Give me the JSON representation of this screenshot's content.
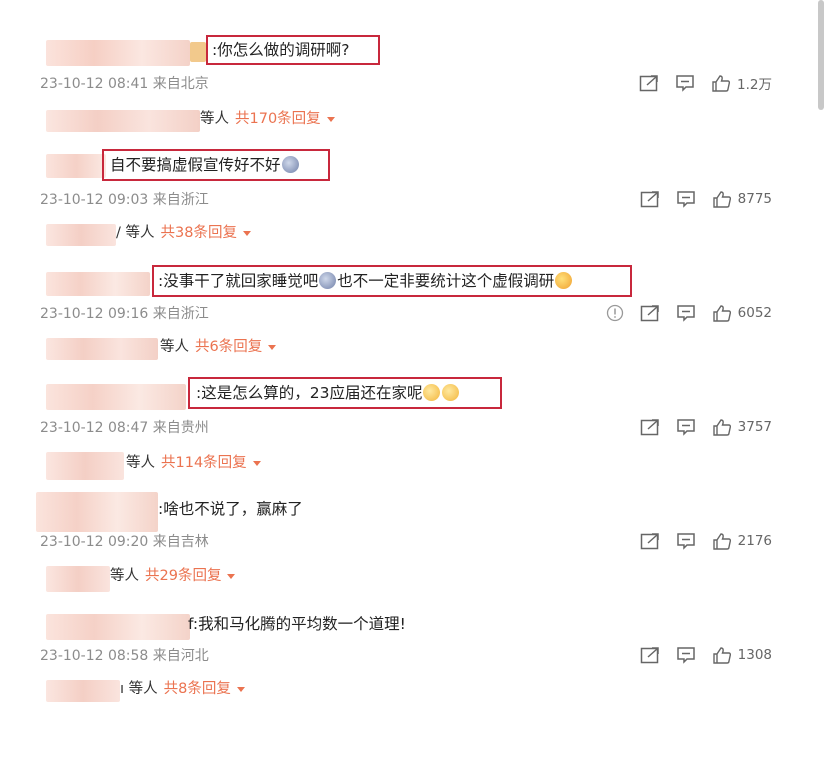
{
  "colors": {
    "accent": "#eb7350",
    "highlight_box": "#c8283c",
    "meta": "#8c8c8c"
  },
  "comments": [
    {
      "text": ":你怎么做的调研啊?",
      "time": "23-10-12 08:41",
      "from": "来自北京",
      "likes": "1.2万",
      "reply_who": "等人",
      "reply_count": "共170条回复"
    },
    {
      "text": "自不要搞虚假宣传好不好",
      "time": "23-10-12 09:03",
      "from": "来自浙江",
      "likes": "8775",
      "reply_who": "/ 等人",
      "reply_count": "共38条回复"
    },
    {
      "text": ":没事干了就回家睡觉吧",
      "text2": "也不一定非要统计这个虚假调研",
      "time": "23-10-12 09:16",
      "from": "来自浙江",
      "likes": "6052",
      "reply_who": "等人",
      "reply_count": "共6条回复"
    },
    {
      "text": ":这是怎么算的，23应届还在家呢",
      "time": "23-10-12 08:47",
      "from": "来自贵州",
      "likes": "3757",
      "reply_who": "等人",
      "reply_count": "共114条回复"
    },
    {
      "text": ":啥也不说了，赢麻了",
      "time": "23-10-12 09:20",
      "from": "来自吉林",
      "likes": "2176",
      "reply_who": "等人",
      "reply_count": "共29条回复"
    },
    {
      "text": "f:我和马化腾的平均数一个道理!",
      "time": "23-10-12 08:58",
      "from": "来自河北",
      "likes": "1308",
      "reply_who": "ı 等人",
      "reply_count": "共8条回复"
    }
  ],
  "icons": {
    "share": "share-icon",
    "comment": "comment-icon",
    "like": "thumbs-up-icon",
    "report": "report-icon"
  }
}
